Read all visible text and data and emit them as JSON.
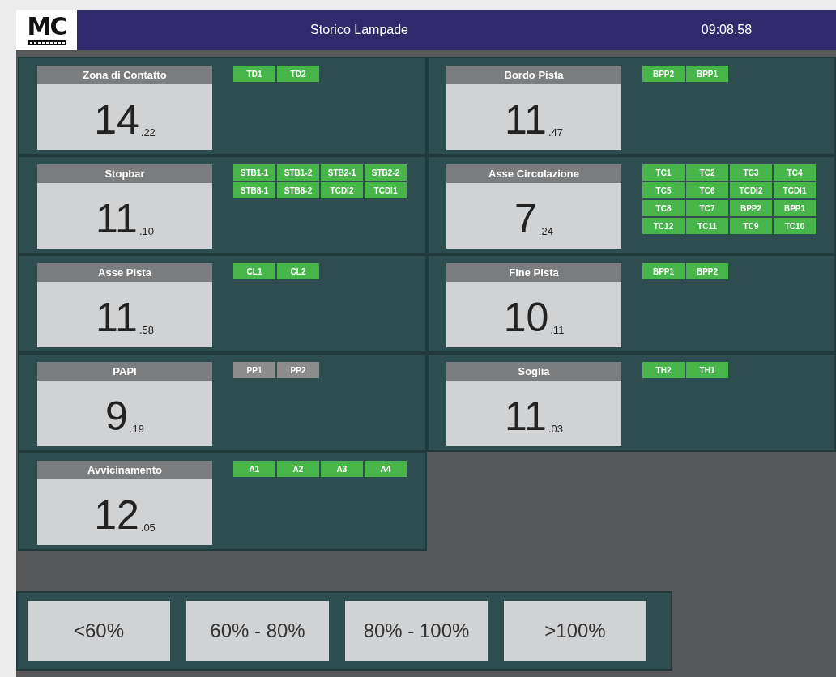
{
  "header": {
    "logo": "MC",
    "title": "Storico Lampade",
    "time": "09:08.58"
  },
  "groups": [
    {
      "name": "Zona di Contatto",
      "value": "14",
      "decimals": ".22",
      "lamps": [
        {
          "label": "TD1",
          "active": true
        },
        {
          "label": "TD2",
          "active": true
        }
      ]
    },
    {
      "name": "Bordo Pista",
      "value": "11",
      "decimals": ".47",
      "lamps": [
        {
          "label": "BPP2",
          "active": true
        },
        {
          "label": "BPP1",
          "active": true
        }
      ]
    },
    {
      "name": "Stopbar",
      "value": "11",
      "decimals": ".10",
      "lamps": [
        {
          "label": "STB1-1",
          "active": true
        },
        {
          "label": "STB1-2",
          "active": true
        },
        {
          "label": "STB2-1",
          "active": true
        },
        {
          "label": "STB2-2",
          "active": true
        },
        {
          "label": "STB8-1",
          "active": true
        },
        {
          "label": "STB8-2",
          "active": true
        },
        {
          "label": "TCDI2",
          "active": true
        },
        {
          "label": "TCDI1",
          "active": true
        }
      ]
    },
    {
      "name": "Asse Circolazione",
      "value": "7",
      "decimals": ".24",
      "lamps": [
        {
          "label": "TC1",
          "active": true
        },
        {
          "label": "TC2",
          "active": true
        },
        {
          "label": "TC3",
          "active": true
        },
        {
          "label": "TC4",
          "active": true
        },
        {
          "label": "TC5",
          "active": true
        },
        {
          "label": "TC6",
          "active": true
        },
        {
          "label": "TCDI2",
          "active": true
        },
        {
          "label": "TCDI1",
          "active": true
        },
        {
          "label": "TC8",
          "active": true
        },
        {
          "label": "TC7",
          "active": true
        },
        {
          "label": "BPP2",
          "active": true
        },
        {
          "label": "BPP1",
          "active": true
        },
        {
          "label": "TC12",
          "active": true
        },
        {
          "label": "TC11",
          "active": true
        },
        {
          "label": "TC9",
          "active": true
        },
        {
          "label": "TC10",
          "active": true
        }
      ]
    },
    {
      "name": "Asse Pista",
      "value": "11",
      "decimals": ".58",
      "lamps": [
        {
          "label": "CL1",
          "active": true
        },
        {
          "label": "CL2",
          "active": true
        }
      ]
    },
    {
      "name": "Fine Pista",
      "value": "10",
      "decimals": ".11",
      "lamps": [
        {
          "label": "BPP1",
          "active": true
        },
        {
          "label": "BPP2",
          "active": true
        }
      ]
    },
    {
      "name": "PAPI",
      "value": "9",
      "decimals": ".19",
      "lamps": [
        {
          "label": "PP1",
          "active": false
        },
        {
          "label": "PP2",
          "active": false
        }
      ]
    },
    {
      "name": "Soglia",
      "value": "11",
      "decimals": ".03",
      "lamps": [
        {
          "label": "TH2",
          "active": true
        },
        {
          "label": "TH1",
          "active": true
        }
      ]
    },
    {
      "name": "Avvicinamento",
      "value": "12",
      "decimals": ".05",
      "lamps": [
        {
          "label": "A1",
          "active": true
        },
        {
          "label": "A2",
          "active": true
        },
        {
          "label": "A3",
          "active": true
        },
        {
          "label": "A4",
          "active": true
        }
      ]
    }
  ],
  "filters": [
    "<60%",
    "60% - 80%",
    "80% - 100%",
    ">100%"
  ]
}
